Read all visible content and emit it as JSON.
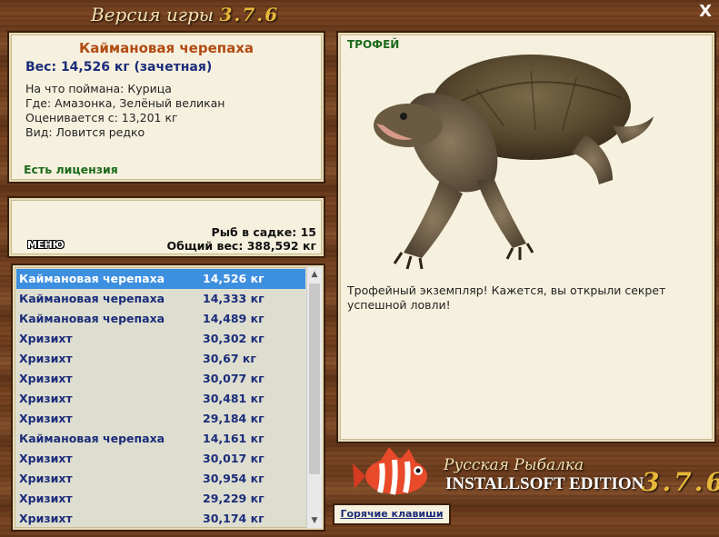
{
  "header": {
    "title_text": "Версия игры",
    "title_version": "3.7.6",
    "close_label": "X"
  },
  "info": {
    "fish_name": "Каймановая черепаха",
    "weight_line": "Вес: 14,526 кг (зачетная)",
    "caught_on": "На что поймана: Курица",
    "where": "Где: Амазонка, Зелёный великан",
    "valued_from": "Оценивается с: 13,201 кг",
    "kind": "Вид: Ловится редко",
    "license": "Есть лицензия"
  },
  "stats": {
    "fish_in_keepnet": "Рыб в садке: 15",
    "total_weight": "Общий вес: 388,592 кг",
    "menu_label": "МЕНЮ"
  },
  "fish_list": [
    {
      "name": "Каймановая черепаха",
      "weight": "14,526 кг",
      "selected": true
    },
    {
      "name": "Каймановая черепаха",
      "weight": "14,333 кг"
    },
    {
      "name": "Каймановая черепаха",
      "weight": "14,489 кг"
    },
    {
      "name": "Хризихт",
      "weight": "30,302 кг"
    },
    {
      "name": "Хризихт",
      "weight": "30,67 кг"
    },
    {
      "name": "Хризихт",
      "weight": "30,077 кг"
    },
    {
      "name": "Хризихт",
      "weight": "30,481 кг"
    },
    {
      "name": "Хризихт",
      "weight": "29,184 кг"
    },
    {
      "name": "Каймановая черепаха",
      "weight": "14,161 кг"
    },
    {
      "name": "Хризихт",
      "weight": "30,017 кг"
    },
    {
      "name": "Хризихт",
      "weight": "30,954 кг"
    },
    {
      "name": "Хризихт",
      "weight": "29,229 кг"
    },
    {
      "name": "Хризихт",
      "weight": "30,174 кг"
    }
  ],
  "trophy": {
    "label": "ТРОФЕЙ",
    "description": "Трофейный экземпляр! Кажется, вы открыли секрет успешной ловли!"
  },
  "logo": {
    "line1": "Русская Рыбалка",
    "line2": "INSTALLSOFT EDITION",
    "version": "3.7.6"
  },
  "hotkeys_label": "Горячие клавиши",
  "icons": {
    "close": "close-icon",
    "scroll_up": "scroll-up-icon",
    "scroll_down": "scroll-down-icon"
  }
}
